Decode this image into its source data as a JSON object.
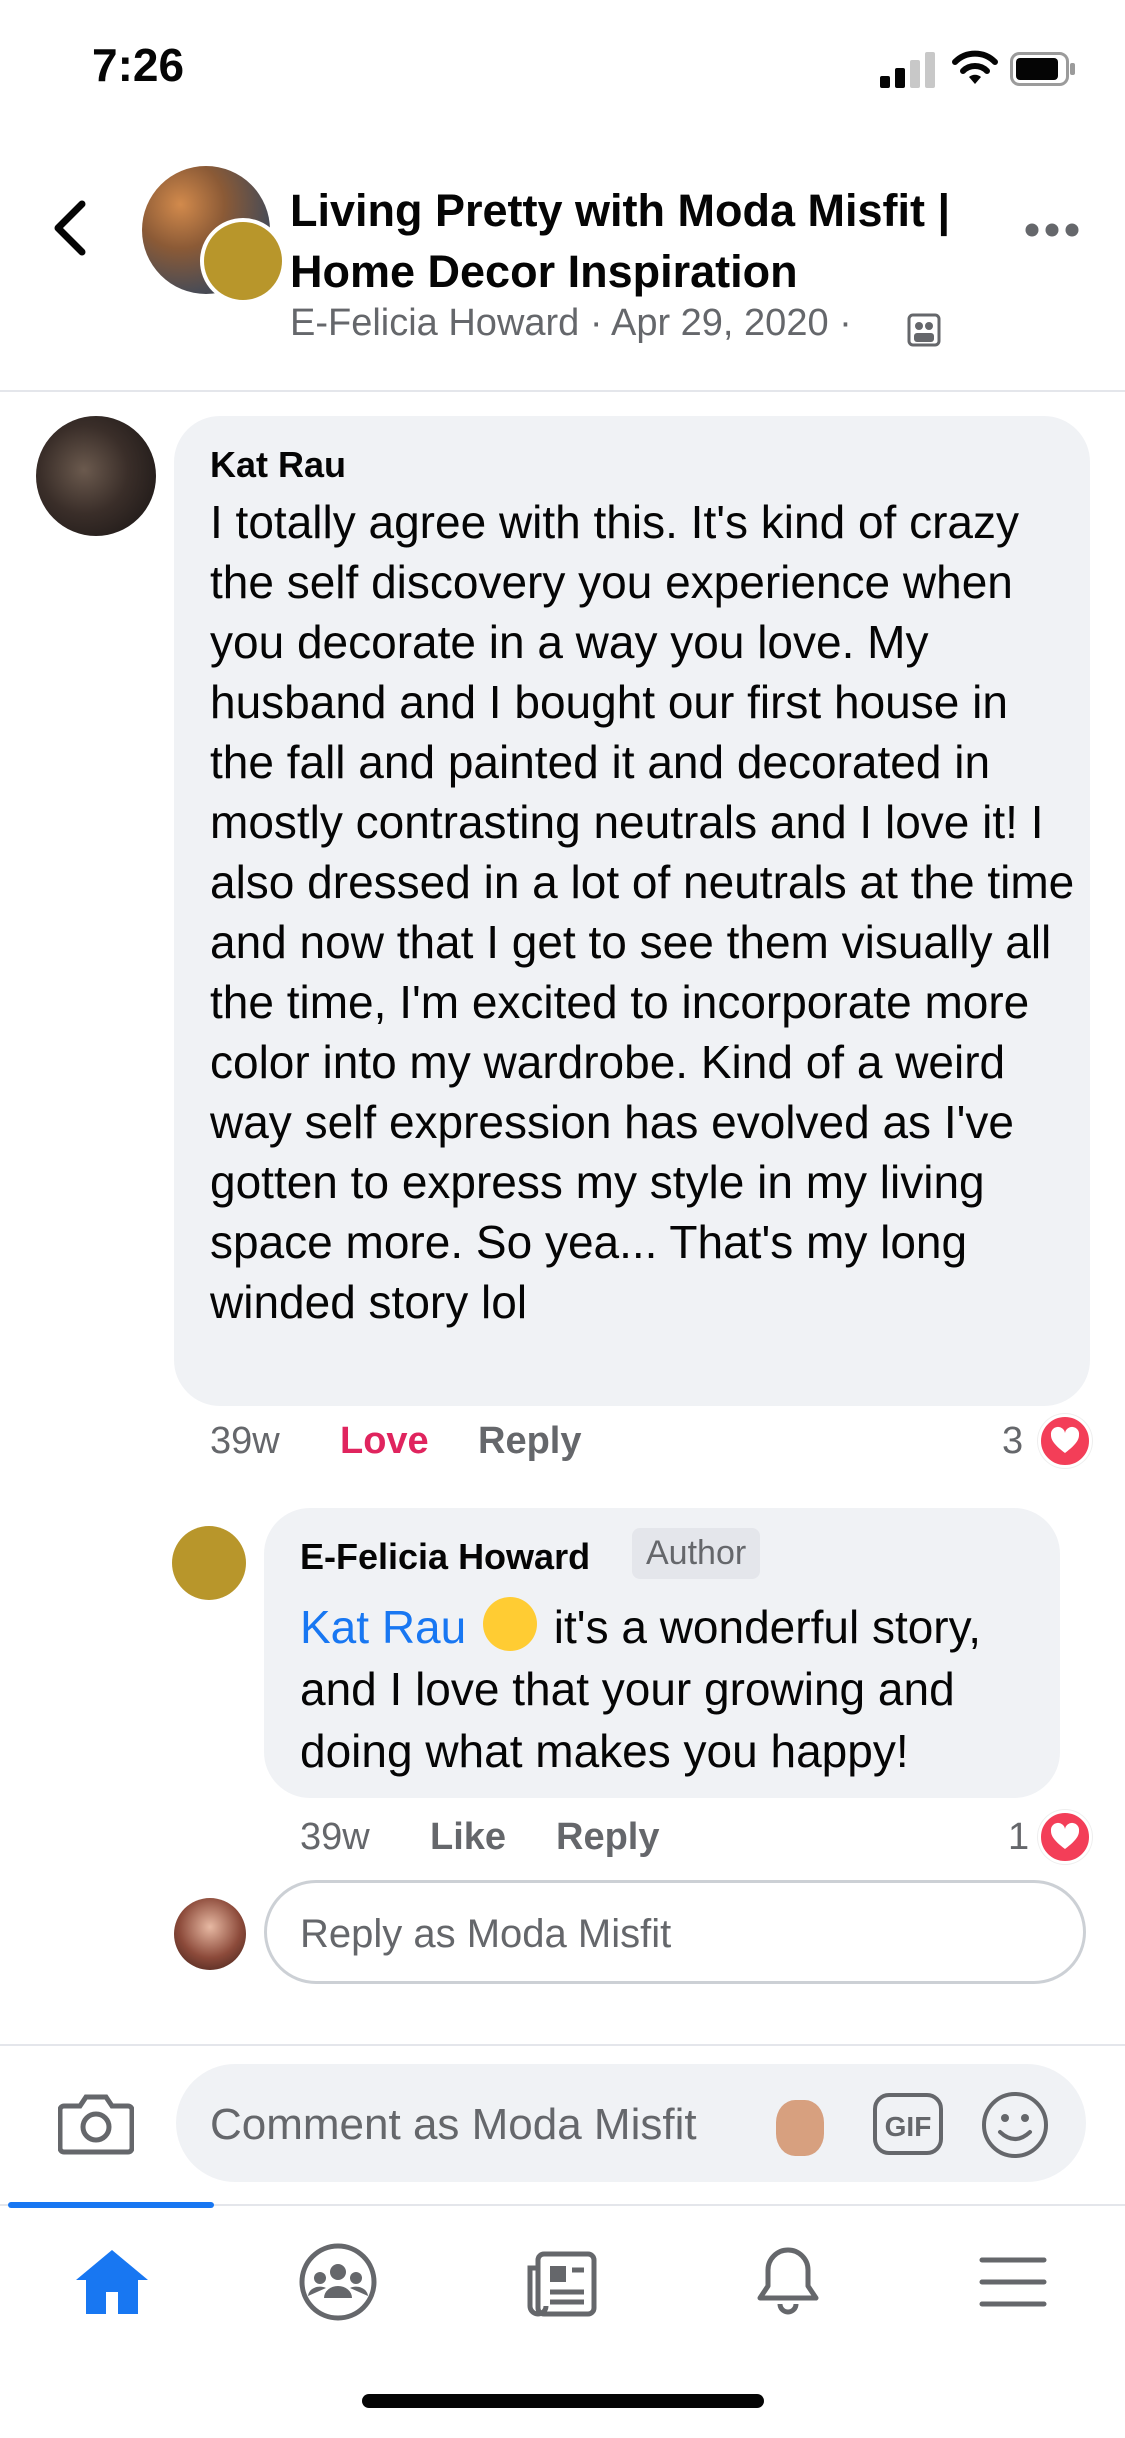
{
  "status_bar": {
    "time": "7:26"
  },
  "header": {
    "title_line1": "Living Pretty with Moda Misfit |",
    "title_line2": "Home Decor Inspiration",
    "meta": "E-Felicia Howard · Apr 29, 2020 ·"
  },
  "comments": [
    {
      "author": "Kat Rau",
      "text": "I totally agree with this. It's kind of crazy the self discovery you experience when you decorate in a way you love. My husband and I bought our first house in the fall and painted it and decorated in mostly contrasting neutrals and I love it! I also dressed in a lot of neutrals at the time and now that I get to see them visually all the time, I'm excited to incorporate more color into my wardrobe. Kind of a weird way self expression has evolved as I've gotten to express my style in my living space more. So yea... That's my long winded story lol",
      "age": "39w",
      "reaction_label": "Love",
      "reply_label": "Reply",
      "reaction_count": "3",
      "reply": {
        "author": "E-Felicia Howard",
        "badge": "Author",
        "mention": "Kat Rau",
        "text": "it's a wonderful story, and I love that your growing and doing what makes you happy!",
        "age": "39w",
        "like_label": "Like",
        "reply_label": "Reply",
        "reaction_count": "1"
      }
    }
  ],
  "reply_input": {
    "placeholder": "Reply as Moda Misfit"
  },
  "composer": {
    "placeholder": "Comment as Moda Misfit",
    "gif_label": "GIF"
  },
  "colors": {
    "accent": "#1877f2",
    "love": "#e0245e",
    "bubble": "#f0f2f5",
    "muted": "#65676b"
  }
}
